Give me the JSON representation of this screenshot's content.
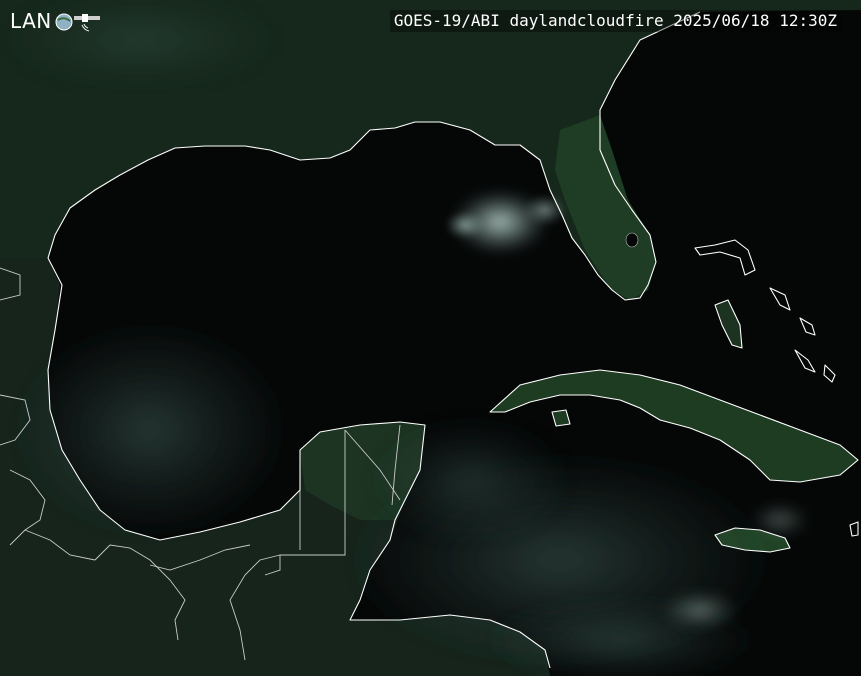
{
  "logo": {
    "text": "LAN",
    "icon": "satellite-icon"
  },
  "caption": {
    "satellite": "GOES-19/ABI",
    "product": "daylandcloudfire",
    "date": "2025/06/18",
    "time": "12:30Z"
  },
  "colors": {
    "ocean": "#050707",
    "land_vegetation": "#1f3a22",
    "land_dark": "#16251a",
    "cloud": "#b9d6cf",
    "coastline": "#ffffff"
  }
}
